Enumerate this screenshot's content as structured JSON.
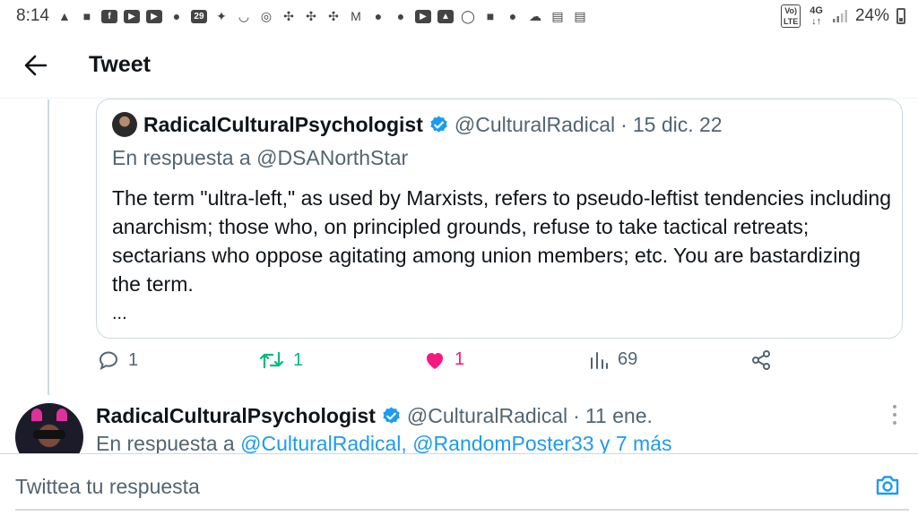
{
  "status_bar": {
    "time": "8:14",
    "battery": "24%",
    "network_tags": [
      "Vo) LTE",
      "4G"
    ],
    "notification_icons": [
      "warning-icon",
      "message-icon",
      "facebook-icon",
      "youtube-icon",
      "youtube-icon",
      "messenger-icon",
      "calendar-icon",
      "twitter-icon",
      "pocket-icon",
      "chrome-icon",
      "slack-icon",
      "slack-icon",
      "slack-icon",
      "gmail-icon",
      "location-icon",
      "location-icon",
      "youtube-icon",
      "image-icon",
      "whatsapp-icon",
      "shopping-icon",
      "location-icon",
      "cloud-icon",
      "window-icon",
      "window-icon"
    ]
  },
  "header": {
    "title": "Tweet"
  },
  "quoted_tweet": {
    "author_name": "RadicalCulturalPsychologist",
    "handle": "@CulturalRadical",
    "separator": "·",
    "date": "15 dic. 22",
    "reply_to": "En respuesta a @DSANorthStar",
    "text": "The term \"ultra-left,\" as used by Marxists, refers to pseudo-leftist tendencies including anarchism; those who, on principled grounds, refuse to take tactical retreats; sectarians who oppose agitating among union members; etc. You are bastardizing the term.",
    "more": "...",
    "verified_color": "#1d9bf0"
  },
  "actions": {
    "replies": "1",
    "retweets": "1",
    "likes": "1",
    "views": "69"
  },
  "reply_tweet": {
    "author_name": "RadicalCulturalPsychologist",
    "handle": "@CulturalRadical",
    "separator": "·",
    "date": "11 ene.",
    "reply_prefix": "En respuesta a ",
    "reply_mentions": "@CulturalRadical, @RandomPoster33 y 7 más"
  },
  "compose": {
    "placeholder": "Twittea tu respuesta"
  },
  "colors": {
    "accent": "#1d9bf0",
    "retweet": "#00ba7c",
    "like": "#f91880",
    "secondary_text": "#536471"
  }
}
